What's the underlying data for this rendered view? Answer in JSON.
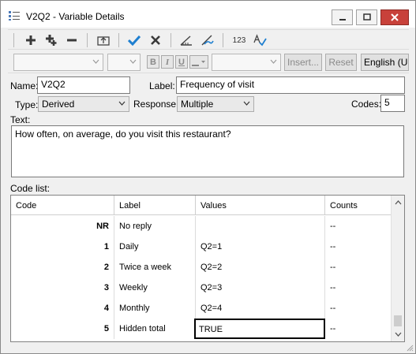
{
  "window": {
    "title": "V2Q2 - Variable Details",
    "title_icon": "variable-list-icon"
  },
  "toolbar": {
    "icons": [
      "add-icon",
      "add-multiple-icon",
      "remove-icon",
      "move-icon",
      "accept-check-icon",
      "cancel-x-icon",
      "measure-icon",
      "compute-icon",
      "numbering-icon",
      "spelling-icon"
    ],
    "numbering_label": "123"
  },
  "format_bar": {
    "bold_label": "B",
    "italic_label": "I",
    "underline_label": "U",
    "insert_label": "Insert...",
    "reset_label": "Reset",
    "language_value": "English (UK"
  },
  "form": {
    "name_label": "Name:",
    "name_value": "V2Q2",
    "label_label": "Label:",
    "label_value": "Frequency of visit",
    "type_label": "Type:",
    "type_value": "Derived",
    "response_label": "Response:",
    "response_value": "Multiple",
    "codes_label": "Codes:",
    "codes_value": "5",
    "text_label": "Text:",
    "text_value": "How often, on average, do you visit this restaurant?"
  },
  "code_list": {
    "title": "Code list:",
    "columns": [
      "Code",
      "Label",
      "Values",
      "Counts"
    ],
    "rows": [
      {
        "code": "NR",
        "label": "No reply",
        "values": "",
        "counts": "--"
      },
      {
        "code": "1",
        "label": "Daily",
        "values": "Q2=1",
        "counts": "--"
      },
      {
        "code": "2",
        "label": "Twice a week",
        "values": "Q2=2",
        "counts": "--"
      },
      {
        "code": "3",
        "label": "Weekly",
        "values": "Q2=3",
        "counts": "--"
      },
      {
        "code": "4",
        "label": "Monthly",
        "values": "Q2=4",
        "counts": "--"
      },
      {
        "code": "5",
        "label": "Hidden total",
        "values": "TRUE",
        "counts": "--"
      }
    ],
    "active_row": 5,
    "active_column": "values"
  },
  "colors": {
    "check": "#1e7fd0",
    "close_button": "#c8413a"
  }
}
